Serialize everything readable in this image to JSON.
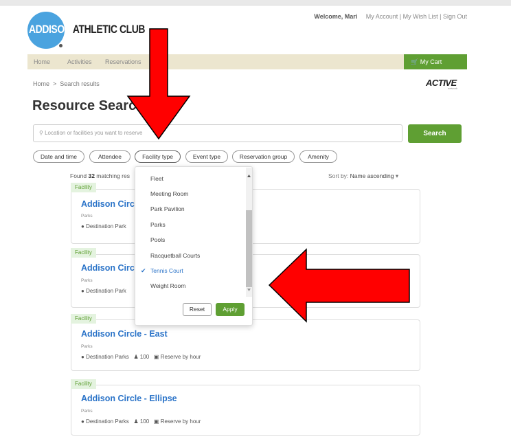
{
  "header": {
    "logo": {
      "word1": "ADDISON",
      "word2": "ATHLETIC CLUB"
    },
    "welcome": "Welcome, Mari",
    "links": [
      "My Account",
      "My Wish List",
      "Sign Out"
    ],
    "nav": [
      "Home",
      "Activities",
      "Reservations"
    ],
    "cart": "My Cart",
    "active_brand": "ACTIVE",
    "active_sub": "network"
  },
  "breadcrumb": "Home  >  Search results",
  "page_title": "Resource Search",
  "search": {
    "placeholder": "Location or facilities you want to reserve",
    "button": "Search"
  },
  "filters": [
    "Date and time",
    "Attendee",
    "Facility type",
    "Event type",
    "Reservation group",
    "Amenity"
  ],
  "results": {
    "found_text": "Found 32 matching res",
    "sort_label": "Sort by:",
    "sort_value": "Name ascending"
  },
  "cards": [
    {
      "tag": "Facility",
      "name": "Addison Circ",
      "category": "Parks",
      "location": "Destination Park",
      "capacity": "",
      "reserve": ""
    },
    {
      "tag": "Facility",
      "name": "Addison Circ",
      "category": "Parks",
      "location": "Destination Park",
      "capacity": "",
      "reserve": ""
    },
    {
      "tag": "Facility",
      "name": "Addison Circle - East",
      "category": "Parks",
      "location": "Destination Parks",
      "capacity": "100",
      "reserve": "Reserve by hour"
    },
    {
      "tag": "Facility",
      "name": "Addison Circle - Ellipse",
      "category": "Parks",
      "location": "Destination Parks",
      "capacity": "100",
      "reserve": "Reserve by hour"
    }
  ],
  "dropdown": {
    "items": [
      "Fleet",
      "Meeting Room",
      "Park Pavilion",
      "Parks",
      "Pools",
      "Racquetball Courts",
      "Tennis Court",
      "Weight Room"
    ],
    "selected": "Tennis Court",
    "reset": "Reset",
    "apply": "Apply"
  },
  "colors": {
    "accent_green": "#5f9f33",
    "link_blue": "#2a73c8",
    "arrow_red": "#ff0000",
    "nav_bg": "#ece6cf"
  }
}
